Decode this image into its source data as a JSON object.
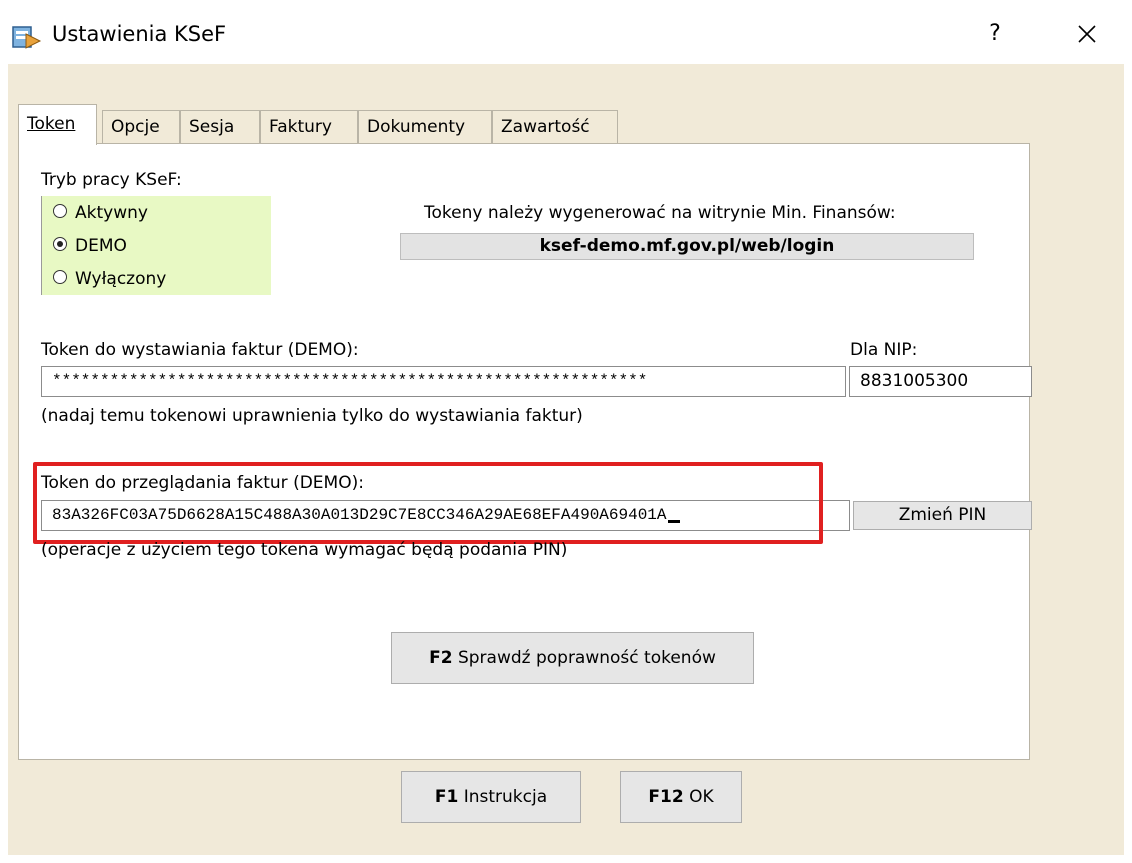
{
  "window": {
    "title": "Ustawienia KSeF",
    "help_glyph": "?",
    "close_glyph": "✕"
  },
  "tabs": [
    {
      "label": "Token",
      "active": true
    },
    {
      "label": "Opcje"
    },
    {
      "label": "Sesja"
    },
    {
      "label": "Faktury"
    },
    {
      "label": "Dokumenty"
    },
    {
      "label": "Zawartość"
    }
  ],
  "mode": {
    "label": "Tryb pracy KSeF:",
    "options": [
      "Aktywny",
      "DEMO",
      "Wyłączony"
    ],
    "selected": "DEMO"
  },
  "info": {
    "text": "Tokeny należy wygenerować na witrynie Min. Finansów:",
    "link": "ksef-demo.mf.gov.pl/web/login"
  },
  "issue_token": {
    "label": "Token do wystawiania faktur (DEMO):",
    "value": "**************************************************************",
    "hint": "(nadaj temu tokenowi uprawnienia tylko do wystawiania faktur)",
    "nip_label": "Dla NIP:",
    "nip_value": "8831005300"
  },
  "view_token": {
    "label": "Token do przeglądania faktur (DEMO):",
    "value": "83A326FC03A75D6628A15C488A30A013D29C7E8CC346A29AE68EFA490A69401A",
    "hint": "(operacje z użyciem tego tokena wymagać będą podania PIN)",
    "pin_button": "Zmień PIN"
  },
  "check_button": {
    "key": "F2",
    "label": "Sprawdź poprawność tokenów"
  },
  "footer": {
    "help": {
      "key": "F1",
      "label": "Instrukcja"
    },
    "ok": {
      "key": "F12",
      "label": "OK"
    }
  },
  "colors": {
    "client_bg": "#f1ead8",
    "radio_bg": "#e8f9c4",
    "highlight": "#e02020"
  }
}
